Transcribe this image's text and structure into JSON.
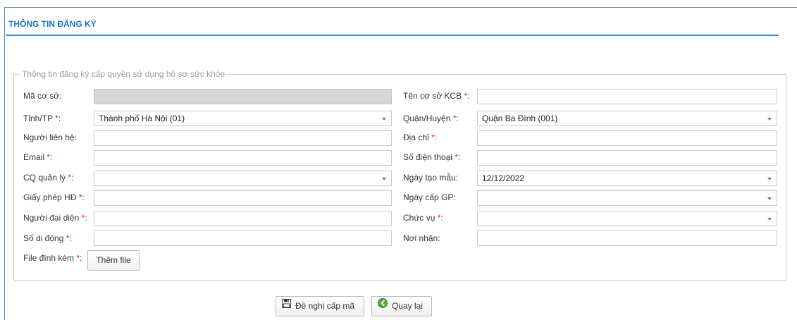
{
  "header": {
    "title": "THÔNG TIN ĐĂNG KÝ"
  },
  "section": {
    "legend": "Thông tin đăng ký cấp quyền sử dụng hồ sơ sức khỏe"
  },
  "form": {
    "ma_co_so": {
      "label": "Mã cơ sở:",
      "value": ""
    },
    "ten_co_so": {
      "label": "Tên cơ sở KCB ",
      "req": "*",
      "colon": ":",
      "value": ""
    },
    "tinh_tp": {
      "label": "Tỉnh/TP ",
      "req": "*",
      "colon": ":",
      "value": "Thành phố Hà Nội (01)"
    },
    "quan_huyen": {
      "label": "Quận/Huyện ",
      "req": "*",
      "colon": ":",
      "value": "Quận Ba Đình (001)"
    },
    "nguoi_lien_he": {
      "label": "Người liên hệ:",
      "value": ""
    },
    "dia_chi": {
      "label": "Địa chỉ ",
      "req": "*",
      "colon": ":",
      "value": ""
    },
    "email": {
      "label": "Email ",
      "req": "*",
      "colon": ":",
      "value": ""
    },
    "so_dien_thoai": {
      "label": "Số điện thoại ",
      "req": "*",
      "colon": ":",
      "value": ""
    },
    "cq_quan_ly": {
      "label": "CQ quản lý ",
      "req": "*",
      "colon": ":",
      "value": ""
    },
    "ngay_tao_mau": {
      "label": "Ngày tạo mẫu:",
      "value": "12/12/2022"
    },
    "giay_phep_hd": {
      "label": "Giấy phép HĐ ",
      "req": "*",
      "colon": ":",
      "value": ""
    },
    "ngay_cap_gp": {
      "label": "Ngày cấp GP:",
      "value": ""
    },
    "nguoi_dai_dien": {
      "label": "Người đại diện ",
      "req": "*",
      "colon": ":",
      "value": ""
    },
    "chuc_vu": {
      "label": "Chức vụ ",
      "req": "*",
      "colon": ":",
      "value": ""
    },
    "so_di_dong": {
      "label": "Số di động ",
      "req": "*",
      "colon": ":",
      "value": ""
    },
    "noi_nhan": {
      "label": "Nơi nhận:",
      "value": ""
    },
    "file_dinh_kem": {
      "label": "File đính kèm ",
      "req": "*",
      "colon": ":"
    },
    "them_file": "Thêm file"
  },
  "actions": {
    "submit": "Đề nghị cấp mã",
    "back": "Quay lại"
  },
  "icons": {
    "submit_icon": "floppy-disk-icon",
    "back_icon": "back-arrow-circle-icon"
  },
  "colors": {
    "accent": "#1a74c6",
    "required": "#e02020",
    "back_icon": "#5aa83a"
  }
}
